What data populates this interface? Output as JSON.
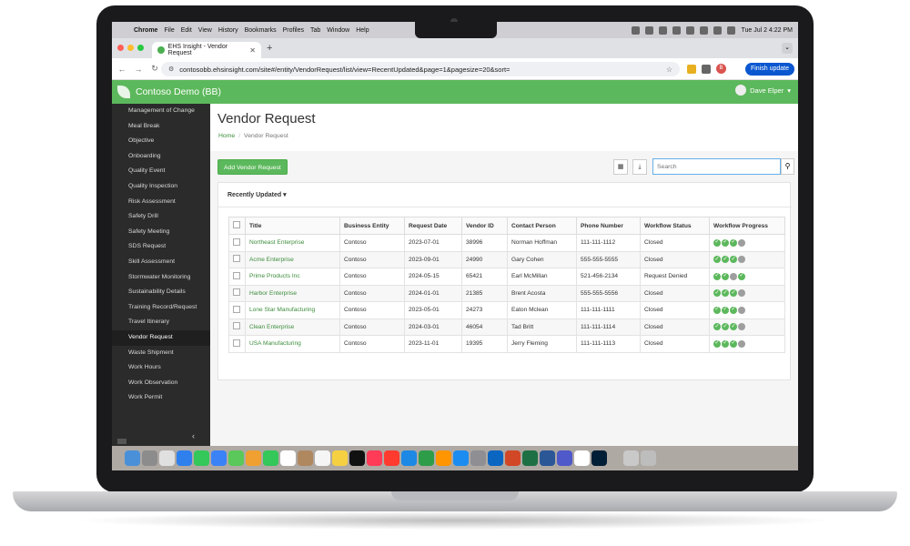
{
  "menubar": {
    "app": "Chrome",
    "items": [
      "File",
      "Edit",
      "View",
      "History",
      "Bookmarks",
      "Profiles",
      "Tab",
      "Window",
      "Help"
    ],
    "clock": "Tue Jul 2  4:22 PM"
  },
  "browser": {
    "tab_title": "EHS Insight - Vendor Request",
    "url": "contosobb.ehsinsight.com/site#/entity/VendorRequest/list/view=RecentUpdated&page=1&pagesize=20&sort=",
    "profile_initial": "B",
    "update_label": "Finish update"
  },
  "app": {
    "title": "Contoso Demo (BB)",
    "user_name": "Dave Elper"
  },
  "sidebar": {
    "items": [
      "Management of Change",
      "Meal Break",
      "Objective",
      "Onboarding",
      "Quality Event",
      "Quality Inspection",
      "Risk Assessment",
      "Safety Drill",
      "Safety Meeting",
      "SDS Request",
      "Skill Assessment",
      "Stormwater Monitoring",
      "Sustainability Details",
      "Training Record/Request",
      "Travel Itinerary",
      "Vendor Request",
      "Waste Shipment",
      "Work Hours",
      "Work Observation",
      "Work Permit"
    ],
    "active": "Vendor Request"
  },
  "page": {
    "title": "Vendor Request",
    "breadcrumb_home": "Home",
    "breadcrumb_current": "Vendor Request",
    "add_button": "Add Vendor Request",
    "search_placeholder": "Search",
    "view_label": "Recently Updated"
  },
  "table": {
    "columns": [
      "Title",
      "Business Entity",
      "Request Date",
      "Vendor ID",
      "Contact Person",
      "Phone Number",
      "Workflow Status",
      "Workflow Progress"
    ],
    "rows": [
      {
        "title": "Northeast Enterprise",
        "entity": "Contoso",
        "date": "2023-07-01",
        "vendor_id": "38996",
        "contact": "Norman Hoffman",
        "phone": "111-111-1112",
        "status": "Closed",
        "progress": [
          "done",
          "done",
          "done",
          "pending"
        ]
      },
      {
        "title": "Acme Enterprise",
        "entity": "Contoso",
        "date": "2023-09-01",
        "vendor_id": "24990",
        "contact": "Gary Cohen",
        "phone": "555-555-5555",
        "status": "Closed",
        "progress": [
          "done",
          "done",
          "done",
          "pending"
        ]
      },
      {
        "title": "Prime Products Inc",
        "entity": "Contoso",
        "date": "2024-05-15",
        "vendor_id": "65421",
        "contact": "Earl McMillan",
        "phone": "521-456-2134",
        "status": "Request Denied",
        "progress": [
          "done",
          "done",
          "pending",
          "done"
        ]
      },
      {
        "title": "Harbor Enterprise",
        "entity": "Contoso",
        "date": "2024-01-01",
        "vendor_id": "21385",
        "contact": "Brent Acosta",
        "phone": "555-555-5556",
        "status": "Closed",
        "progress": [
          "done",
          "done",
          "done",
          "pending"
        ]
      },
      {
        "title": "Lone Star Manufacturing",
        "entity": "Contoso",
        "date": "2023-05-01",
        "vendor_id": "24273",
        "contact": "Eaton Mclean",
        "phone": "111-111-1111",
        "status": "Closed",
        "progress": [
          "done",
          "done",
          "done",
          "pending"
        ]
      },
      {
        "title": "Clean Enterprise",
        "entity": "Contoso",
        "date": "2024-03-01",
        "vendor_id": "46054",
        "contact": "Tad Britt",
        "phone": "111-111-1114",
        "status": "Closed",
        "progress": [
          "done",
          "done",
          "done",
          "pending"
        ]
      },
      {
        "title": "USA Manufacturing",
        "entity": "Contoso",
        "date": "2023-11-01",
        "vendor_id": "19395",
        "contact": "Jerry Fleming",
        "phone": "111-111-1113",
        "status": "Closed",
        "progress": [
          "done",
          "done",
          "done",
          "pending"
        ]
      }
    ]
  },
  "colors": {
    "brand_green": "#5cb85c",
    "link_green": "#3c8d3c",
    "sidebar_bg": "#2b2b2b"
  },
  "dock": {
    "icons": [
      "finder-icon",
      "launchpad-icon",
      "chrome-icon",
      "safari-icon",
      "messages-icon",
      "mail-icon",
      "maps-icon",
      "photos-icon",
      "facetime-icon",
      "calendar-icon",
      "contacts-icon",
      "reminders-icon",
      "freeform-icon",
      "tv-icon",
      "music-icon",
      "news-icon",
      "keynote-icon",
      "numbers-icon",
      "pages-icon",
      "app-store-icon",
      "settings-icon",
      "outlook-icon",
      "powerpoint-icon",
      "excel-icon",
      "word-icon",
      "teams-icon",
      "notion-icon",
      "photoshop-icon",
      "downloads-icon",
      "trash-icon"
    ]
  }
}
